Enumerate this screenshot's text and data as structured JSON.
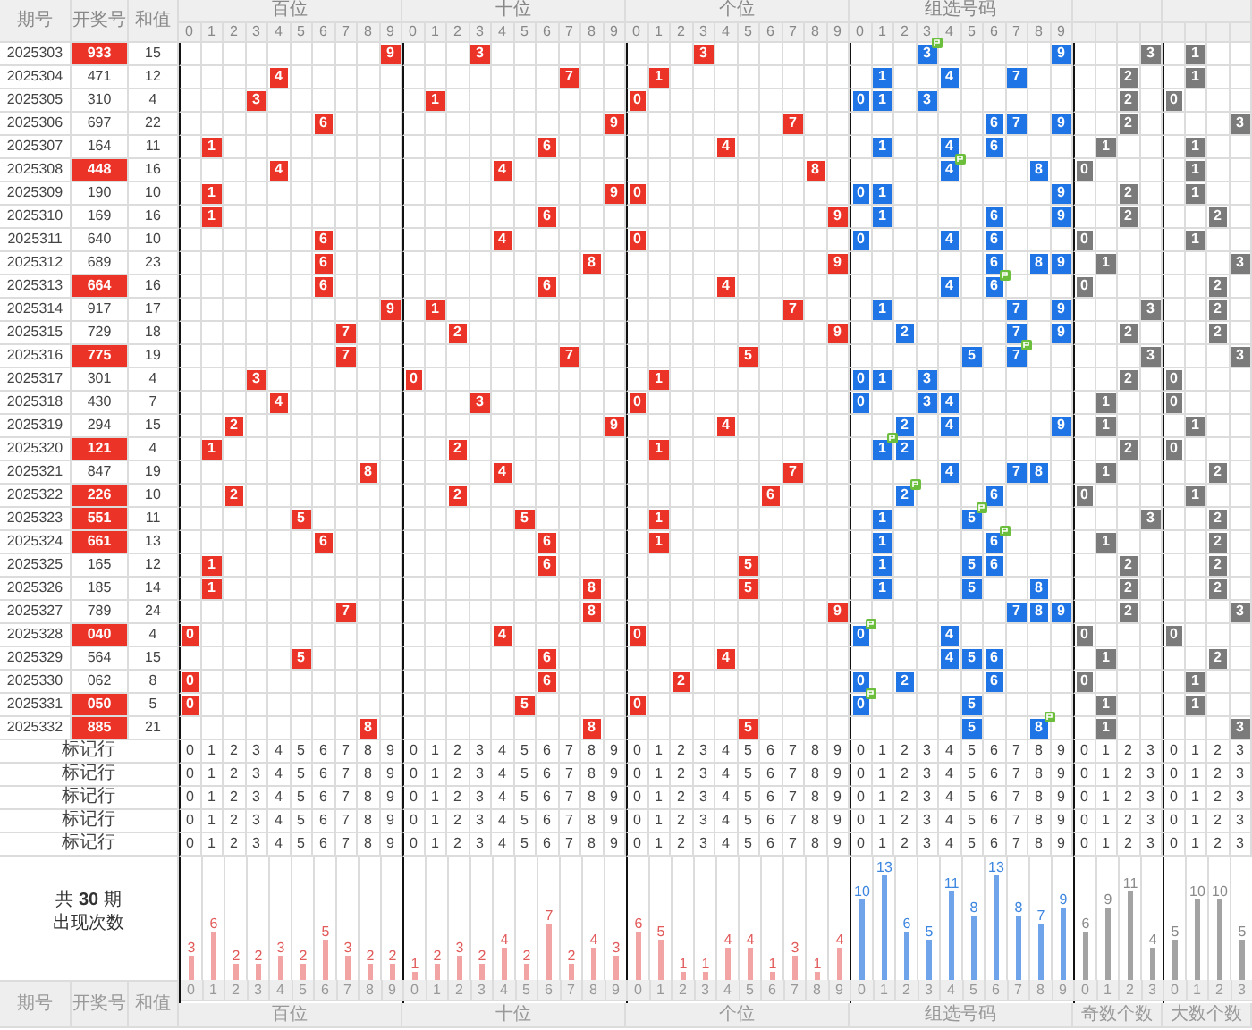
{
  "header": {
    "columns": [
      "期号",
      "开奖号",
      "和值"
    ]
  },
  "sections": [
    {
      "kind": "position",
      "title": "百位",
      "header_digits": [
        "0",
        "1",
        "2",
        "3",
        "4",
        "5",
        "6",
        "7",
        "8",
        "9"
      ],
      "footer_title": "百位",
      "chart_data": {
        "type": "bar",
        "categories": [
          "0",
          "1",
          "2",
          "3",
          "4",
          "5",
          "6",
          "7",
          "8",
          "9"
        ],
        "values": [
          3,
          6,
          2,
          2,
          3,
          2,
          5,
          3,
          2,
          2
        ],
        "data_labels": true
      }
    },
    {
      "kind": "position",
      "title": "十位",
      "header_digits": [
        "0",
        "1",
        "2",
        "3",
        "4",
        "5",
        "6",
        "7",
        "8",
        "9"
      ],
      "footer_title": "十位",
      "chart_data": {
        "type": "bar",
        "categories": [
          "0",
          "1",
          "2",
          "3",
          "4",
          "5",
          "6",
          "7",
          "8",
          "9"
        ],
        "values": [
          1,
          2,
          3,
          2,
          4,
          2,
          7,
          2,
          4,
          3
        ],
        "data_labels": true
      }
    },
    {
      "kind": "position",
      "title": "个位",
      "header_digits": [
        "0",
        "1",
        "2",
        "3",
        "4",
        "5",
        "6",
        "7",
        "8",
        "9"
      ],
      "footer_title": "个位",
      "chart_data": {
        "type": "bar",
        "categories": [
          "0",
          "1",
          "2",
          "3",
          "4",
          "5",
          "6",
          "7",
          "8",
          "9"
        ],
        "values": [
          6,
          5,
          1,
          1,
          4,
          4,
          1,
          3,
          1,
          4
        ],
        "data_labels": true
      }
    },
    {
      "kind": "group",
      "title": "组选号码",
      "header_digits": [
        "0",
        "1",
        "2",
        "3",
        "4",
        "5",
        "6",
        "7",
        "8",
        "9"
      ],
      "footer_title": "组选号码",
      "chart_data": {
        "type": "bar",
        "categories": [
          "0",
          "1",
          "2",
          "3",
          "4",
          "5",
          "6",
          "7",
          "8",
          "9"
        ],
        "values": [
          10,
          13,
          6,
          5,
          11,
          8,
          13,
          8,
          7,
          9
        ],
        "data_labels": true
      }
    },
    {
      "kind": "count",
      "footer_title": "奇数个数",
      "chart_data": {
        "type": "bar",
        "categories": [
          "0",
          "1",
          "2",
          "3"
        ],
        "values": [
          6,
          9,
          11,
          4
        ],
        "data_labels": true
      }
    },
    {
      "kind": "count",
      "footer_title": "大数个数",
      "chart_data": {
        "type": "bar",
        "categories": [
          "0",
          "1",
          "2",
          "3"
        ],
        "values": [
          5,
          10,
          10,
          5
        ],
        "data_labels": true
      }
    }
  ],
  "rows": [
    {
      "period": "2025303",
      "number": "933",
      "sum": "15",
      "pair": true,
      "marks": [
        [
          {
            "digit": "9"
          }
        ],
        [
          {
            "digit": "3"
          }
        ],
        [
          {
            "digit": "3"
          }
        ],
        [
          {
            "digit": "3",
            "pair": true
          },
          {
            "digit": "9",
            "pair": false
          }
        ],
        [
          {
            "digit": "3"
          }
        ],
        [
          {
            "digit": "1"
          }
        ]
      ]
    },
    {
      "period": "2025304",
      "number": "471",
      "sum": "12",
      "pair": false,
      "marks": [
        [
          {
            "digit": "4"
          }
        ],
        [
          {
            "digit": "7"
          }
        ],
        [
          {
            "digit": "1"
          }
        ],
        [
          {
            "digit": "1",
            "pair": false
          },
          {
            "digit": "4",
            "pair": false
          },
          {
            "digit": "7",
            "pair": false
          }
        ],
        [
          {
            "digit": "2"
          }
        ],
        [
          {
            "digit": "1"
          }
        ]
      ]
    },
    {
      "period": "2025305",
      "number": "310",
      "sum": "4",
      "pair": false,
      "marks": [
        [
          {
            "digit": "3"
          }
        ],
        [
          {
            "digit": "1"
          }
        ],
        [
          {
            "digit": "0"
          }
        ],
        [
          {
            "digit": "0",
            "pair": false
          },
          {
            "digit": "1",
            "pair": false
          },
          {
            "digit": "3",
            "pair": false
          }
        ],
        [
          {
            "digit": "2"
          }
        ],
        [
          {
            "digit": "0"
          }
        ]
      ]
    },
    {
      "period": "2025306",
      "number": "697",
      "sum": "22",
      "pair": false,
      "marks": [
        [
          {
            "digit": "6"
          }
        ],
        [
          {
            "digit": "9"
          }
        ],
        [
          {
            "digit": "7"
          }
        ],
        [
          {
            "digit": "6",
            "pair": false
          },
          {
            "digit": "7",
            "pair": false
          },
          {
            "digit": "9",
            "pair": false
          }
        ],
        [
          {
            "digit": "2"
          }
        ],
        [
          {
            "digit": "3"
          }
        ]
      ]
    },
    {
      "period": "2025307",
      "number": "164",
      "sum": "11",
      "pair": false,
      "marks": [
        [
          {
            "digit": "1"
          }
        ],
        [
          {
            "digit": "6"
          }
        ],
        [
          {
            "digit": "4"
          }
        ],
        [
          {
            "digit": "1",
            "pair": false
          },
          {
            "digit": "4",
            "pair": false
          },
          {
            "digit": "6",
            "pair": false
          }
        ],
        [
          {
            "digit": "1"
          }
        ],
        [
          {
            "digit": "1"
          }
        ]
      ]
    },
    {
      "period": "2025308",
      "number": "448",
      "sum": "16",
      "pair": true,
      "marks": [
        [
          {
            "digit": "4"
          }
        ],
        [
          {
            "digit": "4"
          }
        ],
        [
          {
            "digit": "8"
          }
        ],
        [
          {
            "digit": "4",
            "pair": true
          },
          {
            "digit": "8",
            "pair": false
          }
        ],
        [
          {
            "digit": "0"
          }
        ],
        [
          {
            "digit": "1"
          }
        ]
      ]
    },
    {
      "period": "2025309",
      "number": "190",
      "sum": "10",
      "pair": false,
      "marks": [
        [
          {
            "digit": "1"
          }
        ],
        [
          {
            "digit": "9"
          }
        ],
        [
          {
            "digit": "0"
          }
        ],
        [
          {
            "digit": "0",
            "pair": false
          },
          {
            "digit": "1",
            "pair": false
          },
          {
            "digit": "9",
            "pair": false
          }
        ],
        [
          {
            "digit": "2"
          }
        ],
        [
          {
            "digit": "1"
          }
        ]
      ]
    },
    {
      "period": "2025310",
      "number": "169",
      "sum": "16",
      "pair": false,
      "marks": [
        [
          {
            "digit": "1"
          }
        ],
        [
          {
            "digit": "6"
          }
        ],
        [
          {
            "digit": "9"
          }
        ],
        [
          {
            "digit": "1",
            "pair": false
          },
          {
            "digit": "6",
            "pair": false
          },
          {
            "digit": "9",
            "pair": false
          }
        ],
        [
          {
            "digit": "2"
          }
        ],
        [
          {
            "digit": "2"
          }
        ]
      ]
    },
    {
      "period": "2025311",
      "number": "640",
      "sum": "10",
      "pair": false,
      "marks": [
        [
          {
            "digit": "6"
          }
        ],
        [
          {
            "digit": "4"
          }
        ],
        [
          {
            "digit": "0"
          }
        ],
        [
          {
            "digit": "0",
            "pair": false
          },
          {
            "digit": "4",
            "pair": false
          },
          {
            "digit": "6",
            "pair": false
          }
        ],
        [
          {
            "digit": "0"
          }
        ],
        [
          {
            "digit": "1"
          }
        ]
      ]
    },
    {
      "period": "2025312",
      "number": "689",
      "sum": "23",
      "pair": false,
      "marks": [
        [
          {
            "digit": "6"
          }
        ],
        [
          {
            "digit": "8"
          }
        ],
        [
          {
            "digit": "9"
          }
        ],
        [
          {
            "digit": "6",
            "pair": false
          },
          {
            "digit": "8",
            "pair": false
          },
          {
            "digit": "9",
            "pair": false
          }
        ],
        [
          {
            "digit": "1"
          }
        ],
        [
          {
            "digit": "3"
          }
        ]
      ]
    },
    {
      "period": "2025313",
      "number": "664",
      "sum": "16",
      "pair": true,
      "marks": [
        [
          {
            "digit": "6"
          }
        ],
        [
          {
            "digit": "6"
          }
        ],
        [
          {
            "digit": "4"
          }
        ],
        [
          {
            "digit": "4",
            "pair": false
          },
          {
            "digit": "6",
            "pair": true
          }
        ],
        [
          {
            "digit": "0"
          }
        ],
        [
          {
            "digit": "2"
          }
        ]
      ]
    },
    {
      "period": "2025314",
      "number": "917",
      "sum": "17",
      "pair": false,
      "marks": [
        [
          {
            "digit": "9"
          }
        ],
        [
          {
            "digit": "1"
          }
        ],
        [
          {
            "digit": "7"
          }
        ],
        [
          {
            "digit": "1",
            "pair": false
          },
          {
            "digit": "7",
            "pair": false
          },
          {
            "digit": "9",
            "pair": false
          }
        ],
        [
          {
            "digit": "3"
          }
        ],
        [
          {
            "digit": "2"
          }
        ]
      ]
    },
    {
      "period": "2025315",
      "number": "729",
      "sum": "18",
      "pair": false,
      "marks": [
        [
          {
            "digit": "7"
          }
        ],
        [
          {
            "digit": "2"
          }
        ],
        [
          {
            "digit": "9"
          }
        ],
        [
          {
            "digit": "2",
            "pair": false
          },
          {
            "digit": "7",
            "pair": false
          },
          {
            "digit": "9",
            "pair": false
          }
        ],
        [
          {
            "digit": "2"
          }
        ],
        [
          {
            "digit": "2"
          }
        ]
      ]
    },
    {
      "period": "2025316",
      "number": "775",
      "sum": "19",
      "pair": true,
      "marks": [
        [
          {
            "digit": "7"
          }
        ],
        [
          {
            "digit": "7"
          }
        ],
        [
          {
            "digit": "5"
          }
        ],
        [
          {
            "digit": "5",
            "pair": false
          },
          {
            "digit": "7",
            "pair": true
          }
        ],
        [
          {
            "digit": "3"
          }
        ],
        [
          {
            "digit": "3"
          }
        ]
      ]
    },
    {
      "period": "2025317",
      "number": "301",
      "sum": "4",
      "pair": false,
      "marks": [
        [
          {
            "digit": "3"
          }
        ],
        [
          {
            "digit": "0"
          }
        ],
        [
          {
            "digit": "1"
          }
        ],
        [
          {
            "digit": "0",
            "pair": false
          },
          {
            "digit": "1",
            "pair": false
          },
          {
            "digit": "3",
            "pair": false
          }
        ],
        [
          {
            "digit": "2"
          }
        ],
        [
          {
            "digit": "0"
          }
        ]
      ]
    },
    {
      "period": "2025318",
      "number": "430",
      "sum": "7",
      "pair": false,
      "marks": [
        [
          {
            "digit": "4"
          }
        ],
        [
          {
            "digit": "3"
          }
        ],
        [
          {
            "digit": "0"
          }
        ],
        [
          {
            "digit": "0",
            "pair": false
          },
          {
            "digit": "3",
            "pair": false
          },
          {
            "digit": "4",
            "pair": false
          }
        ],
        [
          {
            "digit": "1"
          }
        ],
        [
          {
            "digit": "0"
          }
        ]
      ]
    },
    {
      "period": "2025319",
      "number": "294",
      "sum": "15",
      "pair": false,
      "marks": [
        [
          {
            "digit": "2"
          }
        ],
        [
          {
            "digit": "9"
          }
        ],
        [
          {
            "digit": "4"
          }
        ],
        [
          {
            "digit": "2",
            "pair": false
          },
          {
            "digit": "4",
            "pair": false
          },
          {
            "digit": "9",
            "pair": false
          }
        ],
        [
          {
            "digit": "1"
          }
        ],
        [
          {
            "digit": "1"
          }
        ]
      ]
    },
    {
      "period": "2025320",
      "number": "121",
      "sum": "4",
      "pair": true,
      "marks": [
        [
          {
            "digit": "1"
          }
        ],
        [
          {
            "digit": "2"
          }
        ],
        [
          {
            "digit": "1"
          }
        ],
        [
          {
            "digit": "1",
            "pair": true
          },
          {
            "digit": "2",
            "pair": false
          }
        ],
        [
          {
            "digit": "2"
          }
        ],
        [
          {
            "digit": "0"
          }
        ]
      ]
    },
    {
      "period": "2025321",
      "number": "847",
      "sum": "19",
      "pair": false,
      "marks": [
        [
          {
            "digit": "8"
          }
        ],
        [
          {
            "digit": "4"
          }
        ],
        [
          {
            "digit": "7"
          }
        ],
        [
          {
            "digit": "4",
            "pair": false
          },
          {
            "digit": "7",
            "pair": false
          },
          {
            "digit": "8",
            "pair": false
          }
        ],
        [
          {
            "digit": "1"
          }
        ],
        [
          {
            "digit": "2"
          }
        ]
      ]
    },
    {
      "period": "2025322",
      "number": "226",
      "sum": "10",
      "pair": true,
      "marks": [
        [
          {
            "digit": "2"
          }
        ],
        [
          {
            "digit": "2"
          }
        ],
        [
          {
            "digit": "6"
          }
        ],
        [
          {
            "digit": "2",
            "pair": true
          },
          {
            "digit": "6",
            "pair": false
          }
        ],
        [
          {
            "digit": "0"
          }
        ],
        [
          {
            "digit": "1"
          }
        ]
      ]
    },
    {
      "period": "2025323",
      "number": "551",
      "sum": "11",
      "pair": true,
      "marks": [
        [
          {
            "digit": "5"
          }
        ],
        [
          {
            "digit": "5"
          }
        ],
        [
          {
            "digit": "1"
          }
        ],
        [
          {
            "digit": "1",
            "pair": false
          },
          {
            "digit": "5",
            "pair": true
          }
        ],
        [
          {
            "digit": "3"
          }
        ],
        [
          {
            "digit": "2"
          }
        ]
      ]
    },
    {
      "period": "2025324",
      "number": "661",
      "sum": "13",
      "pair": true,
      "marks": [
        [
          {
            "digit": "6"
          }
        ],
        [
          {
            "digit": "6"
          }
        ],
        [
          {
            "digit": "1"
          }
        ],
        [
          {
            "digit": "1",
            "pair": false
          },
          {
            "digit": "6",
            "pair": true
          }
        ],
        [
          {
            "digit": "1"
          }
        ],
        [
          {
            "digit": "2"
          }
        ]
      ]
    },
    {
      "period": "2025325",
      "number": "165",
      "sum": "12",
      "pair": false,
      "marks": [
        [
          {
            "digit": "1"
          }
        ],
        [
          {
            "digit": "6"
          }
        ],
        [
          {
            "digit": "5"
          }
        ],
        [
          {
            "digit": "1",
            "pair": false
          },
          {
            "digit": "5",
            "pair": false
          },
          {
            "digit": "6",
            "pair": false
          }
        ],
        [
          {
            "digit": "2"
          }
        ],
        [
          {
            "digit": "2"
          }
        ]
      ]
    },
    {
      "period": "2025326",
      "number": "185",
      "sum": "14",
      "pair": false,
      "marks": [
        [
          {
            "digit": "1"
          }
        ],
        [
          {
            "digit": "8"
          }
        ],
        [
          {
            "digit": "5"
          }
        ],
        [
          {
            "digit": "1",
            "pair": false
          },
          {
            "digit": "5",
            "pair": false
          },
          {
            "digit": "8",
            "pair": false
          }
        ],
        [
          {
            "digit": "2"
          }
        ],
        [
          {
            "digit": "2"
          }
        ]
      ]
    },
    {
      "period": "2025327",
      "number": "789",
      "sum": "24",
      "pair": false,
      "marks": [
        [
          {
            "digit": "7"
          }
        ],
        [
          {
            "digit": "8"
          }
        ],
        [
          {
            "digit": "9"
          }
        ],
        [
          {
            "digit": "7",
            "pair": false
          },
          {
            "digit": "8",
            "pair": false
          },
          {
            "digit": "9",
            "pair": false
          }
        ],
        [
          {
            "digit": "2"
          }
        ],
        [
          {
            "digit": "3"
          }
        ]
      ]
    },
    {
      "period": "2025328",
      "number": "040",
      "sum": "4",
      "pair": true,
      "marks": [
        [
          {
            "digit": "0"
          }
        ],
        [
          {
            "digit": "4"
          }
        ],
        [
          {
            "digit": "0"
          }
        ],
        [
          {
            "digit": "0",
            "pair": true
          },
          {
            "digit": "4",
            "pair": false
          }
        ],
        [
          {
            "digit": "0"
          }
        ],
        [
          {
            "digit": "0"
          }
        ]
      ]
    },
    {
      "period": "2025329",
      "number": "564",
      "sum": "15",
      "pair": false,
      "marks": [
        [
          {
            "digit": "5"
          }
        ],
        [
          {
            "digit": "6"
          }
        ],
        [
          {
            "digit": "4"
          }
        ],
        [
          {
            "digit": "4",
            "pair": false
          },
          {
            "digit": "5",
            "pair": false
          },
          {
            "digit": "6",
            "pair": false
          }
        ],
        [
          {
            "digit": "1"
          }
        ],
        [
          {
            "digit": "2"
          }
        ]
      ]
    },
    {
      "period": "2025330",
      "number": "062",
      "sum": "8",
      "pair": false,
      "marks": [
        [
          {
            "digit": "0"
          }
        ],
        [
          {
            "digit": "6"
          }
        ],
        [
          {
            "digit": "2"
          }
        ],
        [
          {
            "digit": "0",
            "pair": false
          },
          {
            "digit": "2",
            "pair": false
          },
          {
            "digit": "6",
            "pair": false
          }
        ],
        [
          {
            "digit": "0"
          }
        ],
        [
          {
            "digit": "1"
          }
        ]
      ]
    },
    {
      "period": "2025331",
      "number": "050",
      "sum": "5",
      "pair": true,
      "marks": [
        [
          {
            "digit": "0"
          }
        ],
        [
          {
            "digit": "5"
          }
        ],
        [
          {
            "digit": "0"
          }
        ],
        [
          {
            "digit": "0",
            "pair": true
          },
          {
            "digit": "5",
            "pair": false
          }
        ],
        [
          {
            "digit": "1"
          }
        ],
        [
          {
            "digit": "1"
          }
        ]
      ]
    },
    {
      "period": "2025332",
      "number": "885",
      "sum": "21",
      "pair": true,
      "marks": [
        [
          {
            "digit": "8"
          }
        ],
        [
          {
            "digit": "8"
          }
        ],
        [
          {
            "digit": "5"
          }
        ],
        [
          {
            "digit": "5",
            "pair": false
          },
          {
            "digit": "8",
            "pair": true
          }
        ],
        [
          {
            "digit": "1"
          }
        ],
        [
          {
            "digit": "3"
          }
        ]
      ]
    }
  ],
  "mark_rows": [
    {
      "label": "标记行",
      "digits": [
        [
          "0",
          "1",
          "2",
          "3",
          "4",
          "5",
          "6",
          "7",
          "8",
          "9"
        ],
        [
          "0",
          "1",
          "2",
          "3",
          "4",
          "5",
          "6",
          "7",
          "8",
          "9"
        ],
        [
          "0",
          "1",
          "2",
          "3",
          "4",
          "5",
          "6",
          "7",
          "8",
          "9"
        ],
        [
          "0",
          "1",
          "2",
          "3",
          "4",
          "5",
          "6",
          "7",
          "8",
          "9"
        ],
        [
          "0",
          "1",
          "2",
          "3"
        ],
        [
          "0",
          "1",
          "2",
          "3"
        ]
      ]
    },
    {
      "label": "标记行",
      "digits": [
        [
          "0",
          "1",
          "2",
          "3",
          "4",
          "5",
          "6",
          "7",
          "8",
          "9"
        ],
        [
          "0",
          "1",
          "2",
          "3",
          "4",
          "5",
          "6",
          "7",
          "8",
          "9"
        ],
        [
          "0",
          "1",
          "2",
          "3",
          "4",
          "5",
          "6",
          "7",
          "8",
          "9"
        ],
        [
          "0",
          "1",
          "2",
          "3",
          "4",
          "5",
          "6",
          "7",
          "8",
          "9"
        ],
        [
          "0",
          "1",
          "2",
          "3"
        ],
        [
          "0",
          "1",
          "2",
          "3"
        ]
      ]
    },
    {
      "label": "标记行",
      "digits": [
        [
          "0",
          "1",
          "2",
          "3",
          "4",
          "5",
          "6",
          "7",
          "8",
          "9"
        ],
        [
          "0",
          "1",
          "2",
          "3",
          "4",
          "5",
          "6",
          "7",
          "8",
          "9"
        ],
        [
          "0",
          "1",
          "2",
          "3",
          "4",
          "5",
          "6",
          "7",
          "8",
          "9"
        ],
        [
          "0",
          "1",
          "2",
          "3",
          "4",
          "5",
          "6",
          "7",
          "8",
          "9"
        ],
        [
          "0",
          "1",
          "2",
          "3"
        ],
        [
          "0",
          "1",
          "2",
          "3"
        ]
      ]
    },
    {
      "label": "标记行",
      "digits": [
        [
          "0",
          "1",
          "2",
          "3",
          "4",
          "5",
          "6",
          "7",
          "8",
          "9"
        ],
        [
          "0",
          "1",
          "2",
          "3",
          "4",
          "5",
          "6",
          "7",
          "8",
          "9"
        ],
        [
          "0",
          "1",
          "2",
          "3",
          "4",
          "5",
          "6",
          "7",
          "8",
          "9"
        ],
        [
          "0",
          "1",
          "2",
          "3",
          "4",
          "5",
          "6",
          "7",
          "8",
          "9"
        ],
        [
          "0",
          "1",
          "2",
          "3"
        ],
        [
          "0",
          "1",
          "2",
          "3"
        ]
      ]
    },
    {
      "label": "标记行",
      "digits": [
        [
          "0",
          "1",
          "2",
          "3",
          "4",
          "5",
          "6",
          "7",
          "8",
          "9"
        ],
        [
          "0",
          "1",
          "2",
          "3",
          "4",
          "5",
          "6",
          "7",
          "8",
          "9"
        ],
        [
          "0",
          "1",
          "2",
          "3",
          "4",
          "5",
          "6",
          "7",
          "8",
          "9"
        ],
        [
          "0",
          "1",
          "2",
          "3",
          "4",
          "5",
          "6",
          "7",
          "8",
          "9"
        ],
        [
          "0",
          "1",
          "2",
          "3"
        ],
        [
          "0",
          "1",
          "2",
          "3"
        ]
      ]
    }
  ],
  "summary": {
    "lines": [
      "共 **30** 期",
      "出现次数"
    ]
  },
  "footer": {
    "columns": [
      "期号",
      "开奖号",
      "和值"
    ]
  }
}
